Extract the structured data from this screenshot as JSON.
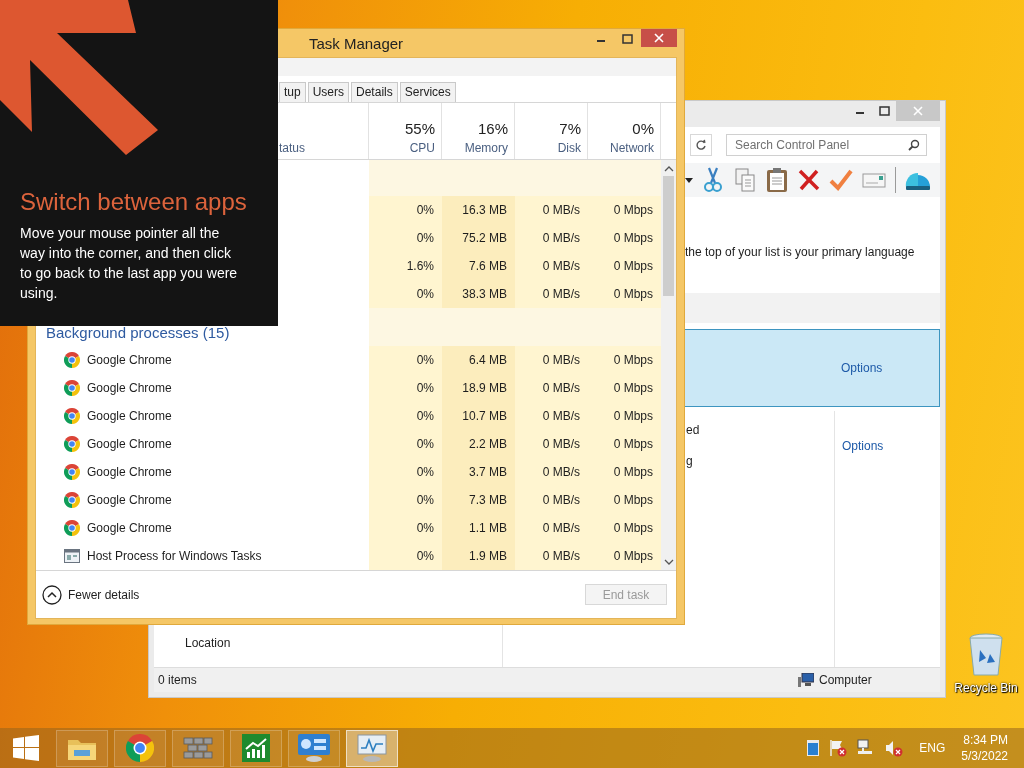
{
  "overlay": {
    "title": "Switch between apps",
    "text": "Move your mouse pointer all the way into the corner, and then click to go back to the last app you were using."
  },
  "control_panel": {
    "search_placeholder": "Search Control Panel",
    "description": "the top of your list is your primary language",
    "rows": [
      {
        "selected": true,
        "action": "Options"
      },
      {
        "selected": false,
        "lines": [
          "ed",
          "g"
        ],
        "action": "Options"
      }
    ],
    "location": "Location",
    "status": "0 items",
    "zone": "Computer"
  },
  "task_manager": {
    "title": "Task Manager",
    "tabs": [
      {
        "label": "tup",
        "selected": false
      },
      {
        "label": "Users",
        "selected": false
      },
      {
        "label": "Details",
        "selected": false
      },
      {
        "label": "Services",
        "selected": false
      }
    ],
    "status_header": "tatus",
    "columns": [
      {
        "usage": "55%",
        "label": "CPU"
      },
      {
        "usage": "16%",
        "label": "Memory"
      },
      {
        "usage": "7%",
        "label": "Disk"
      },
      {
        "usage": "0%",
        "label": "Network"
      }
    ],
    "groups": [
      {
        "rows": [
          {
            "values": [
              "0%",
              "16.3 MB",
              "0 MB/s",
              "0 Mbps"
            ]
          },
          {
            "values": [
              "0%",
              "75.2 MB",
              "0 MB/s",
              "0 Mbps"
            ]
          },
          {
            "values": [
              "1.6%",
              "7.6 MB",
              "0 MB/s",
              "0 Mbps"
            ]
          },
          {
            "values": [
              "0%",
              "38.3 MB",
              "0 MB/s",
              "0 Mbps"
            ]
          }
        ]
      },
      {
        "heading": "Background processes (15)",
        "rows": [
          {
            "kind": "chrome",
            "name": "Google Chrome",
            "values": [
              "0%",
              "6.4 MB",
              "0 MB/s",
              "0 Mbps"
            ]
          },
          {
            "kind": "chrome",
            "name": "Google Chrome",
            "values": [
              "0%",
              "18.9 MB",
              "0 MB/s",
              "0 Mbps"
            ]
          },
          {
            "kind": "chrome",
            "name": "Google Chrome",
            "values": [
              "0%",
              "10.7 MB",
              "0 MB/s",
              "0 Mbps"
            ]
          },
          {
            "kind": "chrome",
            "name": "Google Chrome",
            "values": [
              "0%",
              "2.2 MB",
              "0 MB/s",
              "0 Mbps"
            ]
          },
          {
            "kind": "chrome",
            "name": "Google Chrome",
            "values": [
              "0%",
              "3.7 MB",
              "0 MB/s",
              "0 Mbps"
            ]
          },
          {
            "kind": "chrome",
            "name": "Google Chrome",
            "values": [
              "0%",
              "7.3 MB",
              "0 MB/s",
              "0 Mbps"
            ]
          },
          {
            "kind": "chrome",
            "name": "Google Chrome",
            "values": [
              "0%",
              "1.1 MB",
              "0 MB/s",
              "0 Mbps"
            ]
          },
          {
            "kind": "host",
            "name": "Host Process for Windows Tasks",
            "values": [
              "0%",
              "1.9 MB",
              "0 MB/s",
              "0 Mbps"
            ]
          }
        ]
      }
    ],
    "fewer_details": "Fewer details",
    "end_task": {
      "label": "End task",
      "disabled": true
    }
  },
  "desktop_icons": [
    {
      "label": "Recycle Bin"
    }
  ],
  "taskbar": {
    "apps": [
      {
        "kind": "explorer",
        "active": false
      },
      {
        "kind": "chrome",
        "active": false
      },
      {
        "kind": "firewall",
        "active": false
      },
      {
        "kind": "chart",
        "active": false
      },
      {
        "kind": "control_panel",
        "active": false
      },
      {
        "kind": "task_manager",
        "active": true
      }
    ],
    "language": "ENG",
    "time": "8:34 PM",
    "date": "5/3/2022"
  }
}
